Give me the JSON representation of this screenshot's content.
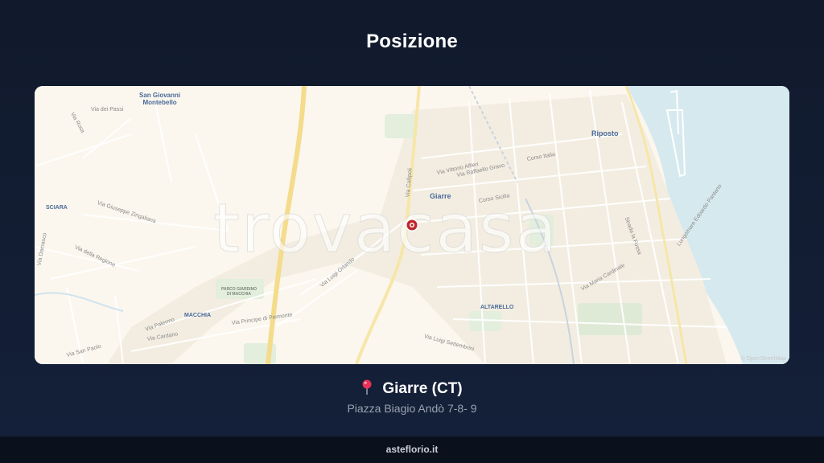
{
  "header": {
    "title": "Posizione"
  },
  "map": {
    "watermark": "trovacasa",
    "attribution": "© OpenStreetMap",
    "towns": {
      "san_giovanni": "San Giovanni\nMontebello",
      "riposto": "Riposto",
      "giarre": "Giarre",
      "sciara": "SCIARA",
      "macchia": "MACCHIA",
      "altarello": "ALTARELLO",
      "parco": "PARCO GIARDINO\nDI MACCHIA"
    },
    "streets": {
      "via_dei_passi": "Via dei Passi",
      "via_rosa": "Via Rosa",
      "via_giuseppe_zingaliana": "Via Giuseppe Zingaliana",
      "via_della_regione": "Via della Regione",
      "via_damasco": "Via Damasco",
      "via_luigi_orlando": "Via Luigi Orlando",
      "via_principe_di_piemonte": "Via Principe di Piemonte",
      "via_palermo": "Via Palermo",
      "via_cardano": "Via Cardano",
      "via_san_paolo": "Via San Paolo",
      "via_vittorio_alfieri": "Via Vittorio Alfieri",
      "via_raffaello": "Via Raffaello Gravo",
      "corso_italia": "Corso Italia",
      "corso_sicilia": "Corso Sicilia",
      "via_callipoli": "Via Callipoli",
      "via_luigi_settembrini": "Via Luigi Settembrini",
      "via_maria": "Via Maria Cardinale",
      "lungomare": "Lungomare Edoardo Pantano",
      "strada": "Strada la Fossa"
    }
  },
  "location": {
    "pin_icon": "round-pushpin-icon",
    "city": "Giarre (CT)",
    "address": "Piazza Biagio Andò 7-8- 9"
  },
  "footer": {
    "site": "asteflorio.it"
  },
  "colors": {
    "background": "#111a2c",
    "pin": "#c0272d",
    "sea": "#d5e8ef",
    "footer": "#0b111c"
  }
}
